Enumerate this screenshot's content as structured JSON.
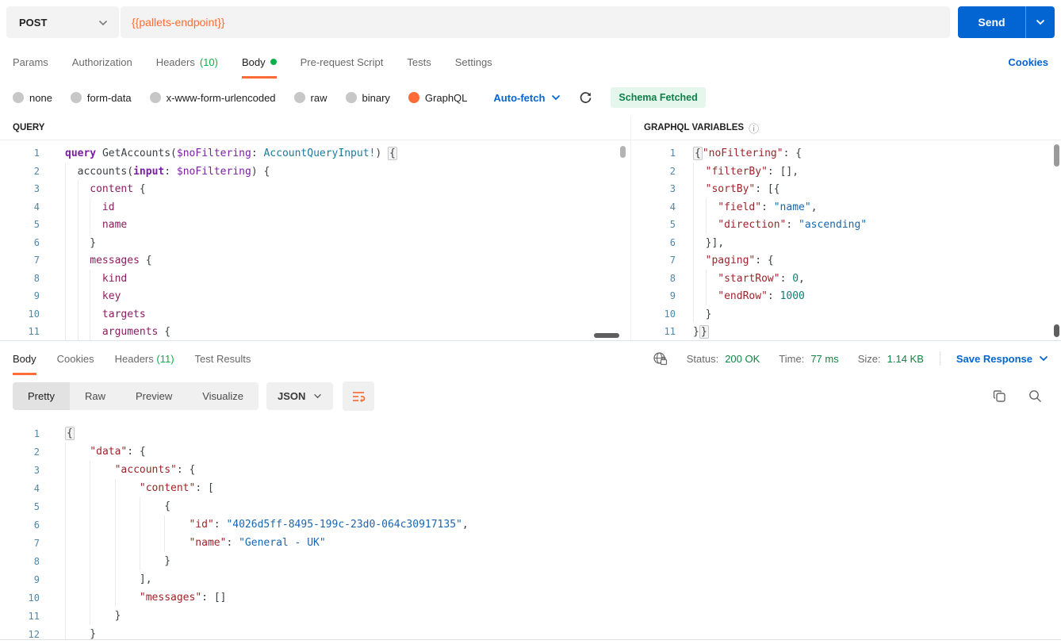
{
  "colors": {
    "accent_orange": "#FF6C37",
    "primary_blue": "#0265D2",
    "success_green": "#0F8443",
    "badge_green_bg": "#E5F7EC",
    "badge_green_text": "#0E7E4A"
  },
  "request": {
    "method": "POST",
    "url": "{{pallets-endpoint}}",
    "send_label": "Send",
    "cookies_link": "Cookies",
    "tabs": [
      {
        "label": "Params"
      },
      {
        "label": "Authorization"
      },
      {
        "label": "Headers",
        "count": "(10)"
      },
      {
        "label": "Body"
      },
      {
        "label": "Pre-request Script"
      },
      {
        "label": "Tests"
      },
      {
        "label": "Settings"
      }
    ],
    "body_types": [
      {
        "label": "none"
      },
      {
        "label": "form-data"
      },
      {
        "label": "x-www-form-urlencoded"
      },
      {
        "label": "raw"
      },
      {
        "label": "binary"
      },
      {
        "label": "GraphQL"
      }
    ],
    "selected_body_type": "GraphQL",
    "auto_fetch_label": "Auto-fetch",
    "schema_badge": "Schema Fetched"
  },
  "query_editor": {
    "title": "QUERY",
    "lines": [
      {
        "n": 1,
        "ind": 0,
        "seg": [
          [
            "kw",
            "query"
          ],
          [
            "pl",
            " GetAccounts("
          ],
          [
            "var",
            "$noFiltering"
          ],
          [
            "pl",
            ": "
          ],
          [
            "ty",
            "AccountQueryInput!"
          ],
          [
            "pl",
            ") "
          ],
          [
            "fold",
            "{"
          ]
        ]
      },
      {
        "n": 2,
        "ind": 1,
        "seg": [
          [
            "pl",
            "accounts("
          ],
          [
            "kw",
            "input"
          ],
          [
            "pl",
            ": "
          ],
          [
            "var",
            "$noFiltering"
          ],
          [
            "pl",
            ") {"
          ]
        ]
      },
      {
        "n": 3,
        "ind": 2,
        "seg": [
          [
            "fi",
            "content"
          ],
          [
            "pl",
            " {"
          ]
        ]
      },
      {
        "n": 4,
        "ind": 3,
        "seg": [
          [
            "fi",
            "id"
          ]
        ]
      },
      {
        "n": 5,
        "ind": 3,
        "seg": [
          [
            "fi",
            "name"
          ]
        ]
      },
      {
        "n": 6,
        "ind": 2,
        "seg": [
          [
            "pl",
            "}"
          ]
        ]
      },
      {
        "n": 7,
        "ind": 2,
        "seg": [
          [
            "fi",
            "messages"
          ],
          [
            "pl",
            " {"
          ]
        ]
      },
      {
        "n": 8,
        "ind": 3,
        "seg": [
          [
            "fi",
            "kind"
          ]
        ]
      },
      {
        "n": 9,
        "ind": 3,
        "seg": [
          [
            "fi",
            "key"
          ]
        ]
      },
      {
        "n": 10,
        "ind": 3,
        "seg": [
          [
            "fi",
            "targets"
          ]
        ]
      },
      {
        "n": 11,
        "ind": 3,
        "seg": [
          [
            "fi",
            "arguments"
          ],
          [
            "pl",
            " {"
          ]
        ]
      }
    ]
  },
  "variables_editor": {
    "title": "GRAPHQL VARIABLES",
    "info_icon": "ⓘ",
    "lines": [
      {
        "n": 1,
        "ind": 0,
        "seg": [
          [
            "fold",
            "{"
          ],
          [
            "key",
            "\"noFiltering\""
          ],
          [
            "pl",
            ": {"
          ]
        ]
      },
      {
        "n": 2,
        "ind": 1,
        "seg": [
          [
            "key",
            "\"filterBy\""
          ],
          [
            "pl",
            ": [],"
          ]
        ]
      },
      {
        "n": 3,
        "ind": 1,
        "seg": [
          [
            "key",
            "\"sortBy\""
          ],
          [
            "pl",
            ": [{"
          ]
        ]
      },
      {
        "n": 4,
        "ind": 2,
        "seg": [
          [
            "key",
            "\"field\""
          ],
          [
            "pl",
            ": "
          ],
          [
            "str",
            "\"name\""
          ],
          [
            "pl",
            ","
          ]
        ]
      },
      {
        "n": 5,
        "ind": 2,
        "seg": [
          [
            "key",
            "\"direction\""
          ],
          [
            "pl",
            ": "
          ],
          [
            "str",
            "\"ascending\""
          ]
        ]
      },
      {
        "n": 6,
        "ind": 1,
        "seg": [
          [
            "pl",
            "}],"
          ]
        ]
      },
      {
        "n": 7,
        "ind": 1,
        "seg": [
          [
            "key",
            "\"paging\""
          ],
          [
            "pl",
            ": {"
          ]
        ]
      },
      {
        "n": 8,
        "ind": 2,
        "seg": [
          [
            "key",
            "\"startRow\""
          ],
          [
            "pl",
            ": "
          ],
          [
            "num",
            "0"
          ],
          [
            "pl",
            ","
          ]
        ]
      },
      {
        "n": 9,
        "ind": 2,
        "seg": [
          [
            "key",
            "\"endRow\""
          ],
          [
            "pl",
            ": "
          ],
          [
            "num",
            "1000"
          ]
        ]
      },
      {
        "n": 10,
        "ind": 1,
        "seg": [
          [
            "pl",
            "}"
          ]
        ]
      },
      {
        "n": 11,
        "ind": 0,
        "seg": [
          [
            "pl",
            "}"
          ],
          [
            "fold",
            "}"
          ]
        ]
      }
    ]
  },
  "response": {
    "tabs": [
      {
        "label": "Body"
      },
      {
        "label": "Cookies"
      },
      {
        "label": "Headers",
        "count": "(11)"
      },
      {
        "label": "Test Results"
      }
    ],
    "status_label": "Status:",
    "status_value": "200 OK",
    "time_label": "Time:",
    "time_value": "77 ms",
    "size_label": "Size:",
    "size_value": "1.14 KB",
    "save_label": "Save Response",
    "view_tabs": [
      {
        "label": "Pretty"
      },
      {
        "label": "Raw"
      },
      {
        "label": "Preview"
      },
      {
        "label": "Visualize"
      }
    ],
    "format_label": "JSON",
    "body_editor": {
      "lines": [
        {
          "n": 1,
          "ind": 0,
          "seg": [
            [
              "fold",
              "{"
            ]
          ]
        },
        {
          "n": 2,
          "ind": 1,
          "seg": [
            [
              "key",
              "\"data\""
            ],
            [
              "pl",
              ": {"
            ]
          ]
        },
        {
          "n": 3,
          "ind": 2,
          "seg": [
            [
              "key",
              "\"accounts\""
            ],
            [
              "pl",
              ": {"
            ]
          ]
        },
        {
          "n": 4,
          "ind": 3,
          "seg": [
            [
              "key",
              "\"content\""
            ],
            [
              "pl",
              ": ["
            ]
          ]
        },
        {
          "n": 5,
          "ind": 4,
          "seg": [
            [
              "pl",
              "{"
            ]
          ]
        },
        {
          "n": 6,
          "ind": 5,
          "seg": [
            [
              "key",
              "\"id\""
            ],
            [
              "pl",
              ": "
            ],
            [
              "str",
              "\"4026d5ff-8495-199c-23d0-064c30917135\""
            ],
            [
              "pl",
              ","
            ]
          ]
        },
        {
          "n": 7,
          "ind": 5,
          "seg": [
            [
              "key",
              "\"name\""
            ],
            [
              "pl",
              ": "
            ],
            [
              "str",
              "\"General - UK\""
            ]
          ]
        },
        {
          "n": 8,
          "ind": 4,
          "seg": [
            [
              "pl",
              "}"
            ]
          ]
        },
        {
          "n": 9,
          "ind": 3,
          "seg": [
            [
              "pl",
              "],"
            ]
          ]
        },
        {
          "n": 10,
          "ind": 3,
          "seg": [
            [
              "key",
              "\"messages\""
            ],
            [
              "pl",
              ": []"
            ]
          ]
        },
        {
          "n": 11,
          "ind": 2,
          "seg": [
            [
              "pl",
              "}"
            ]
          ]
        },
        {
          "n": 12,
          "ind": 1,
          "seg": [
            [
              "pl",
              "}"
            ]
          ]
        }
      ]
    }
  }
}
